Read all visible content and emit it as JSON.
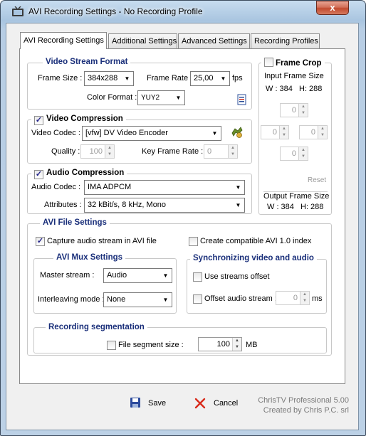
{
  "window": {
    "title": "AVI Recording Settings - No Recording Profile",
    "close_glyph": "x"
  },
  "tabs": [
    {
      "label": "AVI Recording Settings",
      "active": true
    },
    {
      "label": "Additional Settings"
    },
    {
      "label": "Advanced Settings"
    },
    {
      "label": "Recording Profiles"
    }
  ],
  "video_stream": {
    "title": "Video Stream Format",
    "frame_size_label": "Frame Size :",
    "frame_size_value": "384x288",
    "frame_rate_label": "Frame Rate :",
    "frame_rate_value": "25,00",
    "fps_label": "fps",
    "color_format_label": "Color Format :",
    "color_format_value": "YUY2"
  },
  "video_compression": {
    "title": "Video Compression",
    "checked": true,
    "codec_label": "Video Codec :",
    "codec_value": "[vfw] DV Video Encoder",
    "quality_label": "Quality :",
    "quality_value": "100",
    "keyframe_label": "Key Frame Rate :",
    "keyframe_value": "0"
  },
  "audio_compression": {
    "title": "Audio Compression",
    "checked": true,
    "codec_label": "Audio Codec :",
    "codec_value": "IMA ADPCM",
    "attributes_label": "Attributes :",
    "attributes_value": "32 kBit/s, 8 kHz, Mono"
  },
  "frame_crop": {
    "title": "Frame Crop",
    "checked": false,
    "input_size_label": "Input Frame Size",
    "input_w": "W : 384",
    "input_h": "H: 288",
    "top": "0",
    "left": "0",
    "right": "0",
    "bottom": "0",
    "reset_label": "Reset",
    "output_size_label": "Output Frame Size",
    "output_w": "W : 384",
    "output_h": "H: 288"
  },
  "avi_file": {
    "title": "AVI File Settings",
    "capture_audio_label": "Capture audio stream in AVI file",
    "capture_audio_checked": true,
    "compat_label": "Create compatible  AVI 1.0 index",
    "compat_checked": false
  },
  "mux": {
    "title": "AVI Mux Settings",
    "master_label": "Master stream :",
    "master_value": "Audio",
    "interleave_label": "Interleaving mode :",
    "interleave_value": "None"
  },
  "sync": {
    "title": "Synchronizing video and audio",
    "use_offset_label": "Use streams offset",
    "offset_label": "Offset audio stream :",
    "offset_value": "0",
    "offset_unit": "ms"
  },
  "segmentation": {
    "title": "Recording segmentation",
    "file_segment_label": "File segment size :",
    "file_segment_value": "100",
    "unit": "MB"
  },
  "footer": {
    "save_label": "Save",
    "cancel_label": "Cancel",
    "product": "ChrisTV Professional 5.00",
    "credit": "Created by Chris P.C. srl"
  },
  "colors": {
    "group_title": "#1a2f7a",
    "disabled_text": "#9a9a9a",
    "window_frame": "#a9c5e0"
  },
  "icons": [
    "app-icon",
    "close-icon",
    "info-icon",
    "plugin-icon",
    "save-icon",
    "cancel-icon",
    "dropdown-arrow-icon",
    "checkmark-icon",
    "spin-arrows-icon"
  ]
}
